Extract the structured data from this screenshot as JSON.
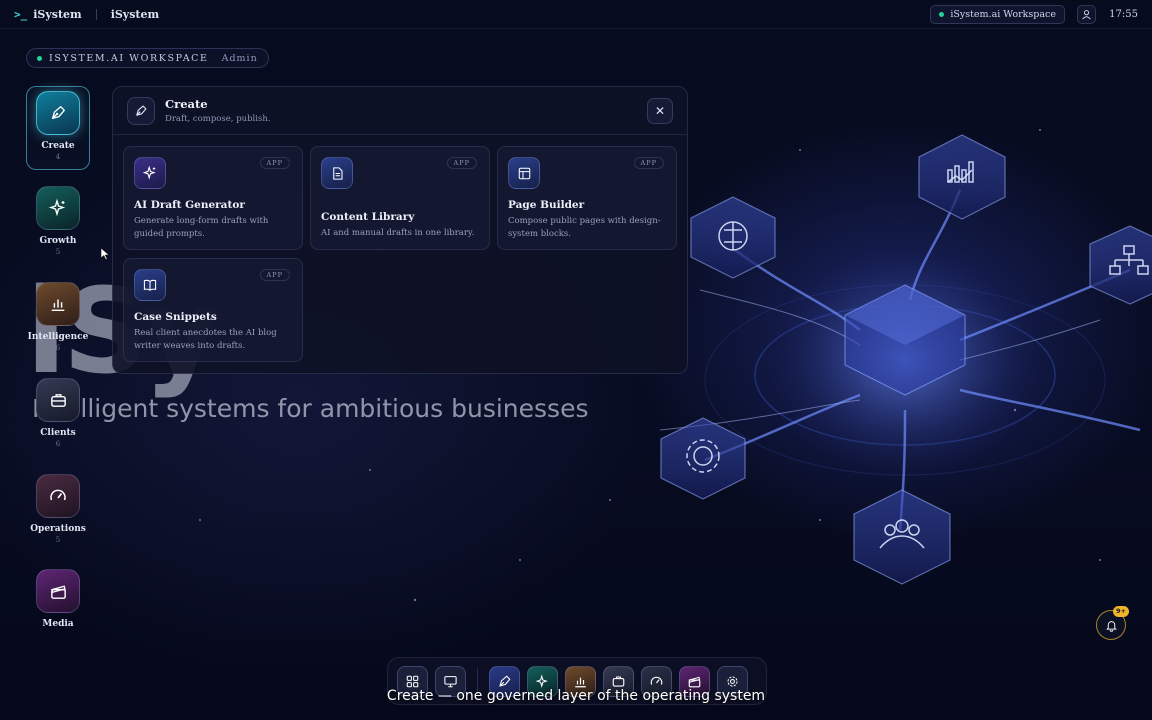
{
  "topbar": {
    "brand": "iSystem",
    "title": "iSystem",
    "workspace_chip": "iSystem.ai Workspace",
    "clock": "17:55"
  },
  "workspace_pill": {
    "name": "ISYSTEM.AI WORKSPACE",
    "role": "Admin"
  },
  "hero": {
    "big_text": "iSy",
    "tagline": "Intelligent systems for ambitious businesses"
  },
  "rail": {
    "items": [
      {
        "label": "Create",
        "count": "4",
        "icon": "pen-nib-icon",
        "color": "#0e6a86"
      },
      {
        "label": "Growth",
        "count": "5",
        "icon": "sparkles-icon",
        "color": "#0f4b4a"
      },
      {
        "label": "Intelligence",
        "count": "6",
        "icon": "bar-chart-icon",
        "color": "#5a3a24"
      },
      {
        "label": "Clients",
        "count": "6",
        "icon": "briefcase-icon",
        "color": "#2a2f44"
      },
      {
        "label": "Operations",
        "count": "5",
        "icon": "gauge-icon",
        "color": "#3a2436"
      },
      {
        "label": "Media",
        "count": "",
        "icon": "clapperboard-icon",
        "color": "#4a1f5c"
      }
    ]
  },
  "panel": {
    "title": "Create",
    "subtitle": "Draft, compose, publish.",
    "cards": [
      {
        "title": "AI Draft Generator",
        "desc": "Generate long-form drafts with guided prompts.",
        "badge": "APP",
        "icon": "sparkles-icon"
      },
      {
        "title": "Content Library",
        "desc": "AI and manual drafts in one library.",
        "badge": "APP",
        "icon": "document-icon"
      },
      {
        "title": "Page Builder",
        "desc": "Compose public pages with design-system blocks.",
        "badge": "APP",
        "icon": "layout-icon"
      },
      {
        "title": "Case Snippets",
        "desc": "Real client anecdotes the AI blog writer weaves into drafts.",
        "badge": "APP",
        "icon": "book-open-icon"
      }
    ]
  },
  "dock": {
    "items": [
      "grid-icon",
      "monitor-icon",
      "pen-nib-icon",
      "sparkles-icon",
      "bar-chart-icon",
      "briefcase-icon",
      "gauge-icon",
      "clapperboard-icon",
      "gear-icon"
    ]
  },
  "notification": {
    "badge": "9+"
  },
  "caption": "Create — one governed layer of the operating system",
  "colors": {
    "accent": "#3fd6d0",
    "status_dot": "#22d39a",
    "notif": "#f0b32a"
  }
}
